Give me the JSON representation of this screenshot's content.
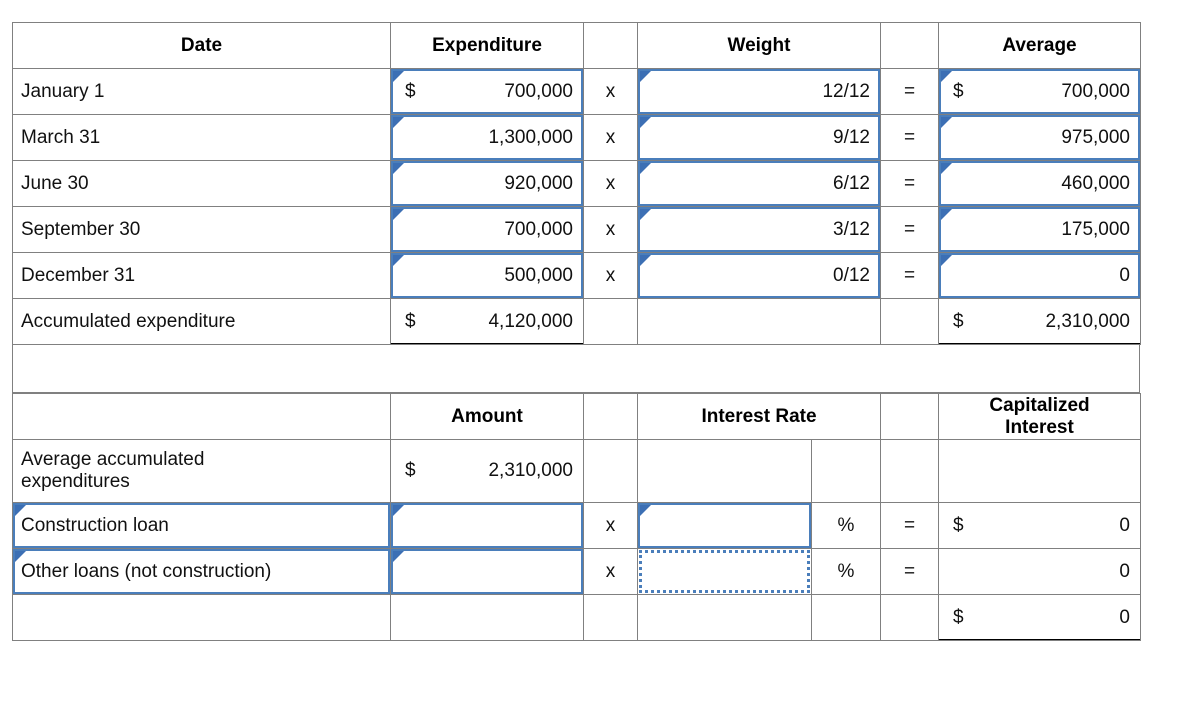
{
  "expenditure_table": {
    "name": "weighted-average-accumulated-expenditures",
    "headers": {
      "date": "Date",
      "expenditure": "Expenditure",
      "multiply_blank": "",
      "weight": "Weight",
      "equals_blank": "",
      "average": "Average"
    },
    "operators": {
      "times": "x",
      "equals": "="
    },
    "currency_symbol": "$",
    "rows": [
      {
        "date": "January 1",
        "expenditure_currency": "$",
        "expenditure": "700,000",
        "times": "x",
        "weight": "12/12",
        "equals": "=",
        "average_currency": "$",
        "average": "700,000"
      },
      {
        "date": "March 31",
        "expenditure_currency": "",
        "expenditure": "1,300,000",
        "times": "x",
        "weight": "9/12",
        "equals": "=",
        "average_currency": "",
        "average": "975,000"
      },
      {
        "date": "June 30",
        "expenditure_currency": "",
        "expenditure": "920,000",
        "times": "x",
        "weight": "6/12",
        "equals": "=",
        "average_currency": "",
        "average": "460,000"
      },
      {
        "date": "September 30",
        "expenditure_currency": "",
        "expenditure": "700,000",
        "times": "x",
        "weight": "3/12",
        "equals": "=",
        "average_currency": "",
        "average": "175,000"
      },
      {
        "date": "December 31",
        "expenditure_currency": "",
        "expenditure": "500,000",
        "times": "x",
        "weight": "0/12",
        "equals": "=",
        "average_currency": "",
        "average": "0"
      }
    ],
    "total_row": {
      "label": "Accumulated expenditure",
      "expenditure_currency": "$",
      "expenditure": "4,120,000",
      "average_currency": "$",
      "average": "2,310,000"
    }
  },
  "capitalized_table": {
    "name": "capitalized-interest-computation",
    "headers": {
      "description": "",
      "amount": "Amount",
      "multiply_blank": "",
      "interest_rate": "Interest Rate",
      "percent_blank": "",
      "equals_blank": "",
      "capitalized_interest_line1": "Capitalized",
      "capitalized_interest_line2": "Interest"
    },
    "operators": {
      "times": "x",
      "equals": "=",
      "percent": "%"
    },
    "rows": [
      {
        "label_line1": "Average accumulated",
        "label_line2": "expenditures",
        "amount_currency": "$",
        "amount": "2,310,000",
        "times": "",
        "rate": "",
        "percent": "",
        "equals": "",
        "interest_currency": "",
        "interest": ""
      },
      {
        "label_line1": "Construction loan",
        "label_line2": "",
        "amount_currency": "",
        "amount": "",
        "times": "x",
        "rate": "",
        "percent": "%",
        "equals": "=",
        "interest_currency": "$",
        "interest": "0"
      },
      {
        "label_line1": "Other loans (not construction)",
        "label_line2": "",
        "amount_currency": "",
        "amount": "",
        "times": "x",
        "rate": "",
        "percent": "%",
        "equals": "=",
        "interest_currency": "",
        "interest": "0"
      }
    ],
    "total_row": {
      "label": "",
      "interest_currency": "$",
      "interest": "0"
    }
  },
  "colors": {
    "header_blue": "#8DB4E2",
    "input_border_blue": "#4A7EBB",
    "grid_line": "#808080",
    "total_highlight_yellow": "#FCF3B5",
    "text": "#111111"
  }
}
